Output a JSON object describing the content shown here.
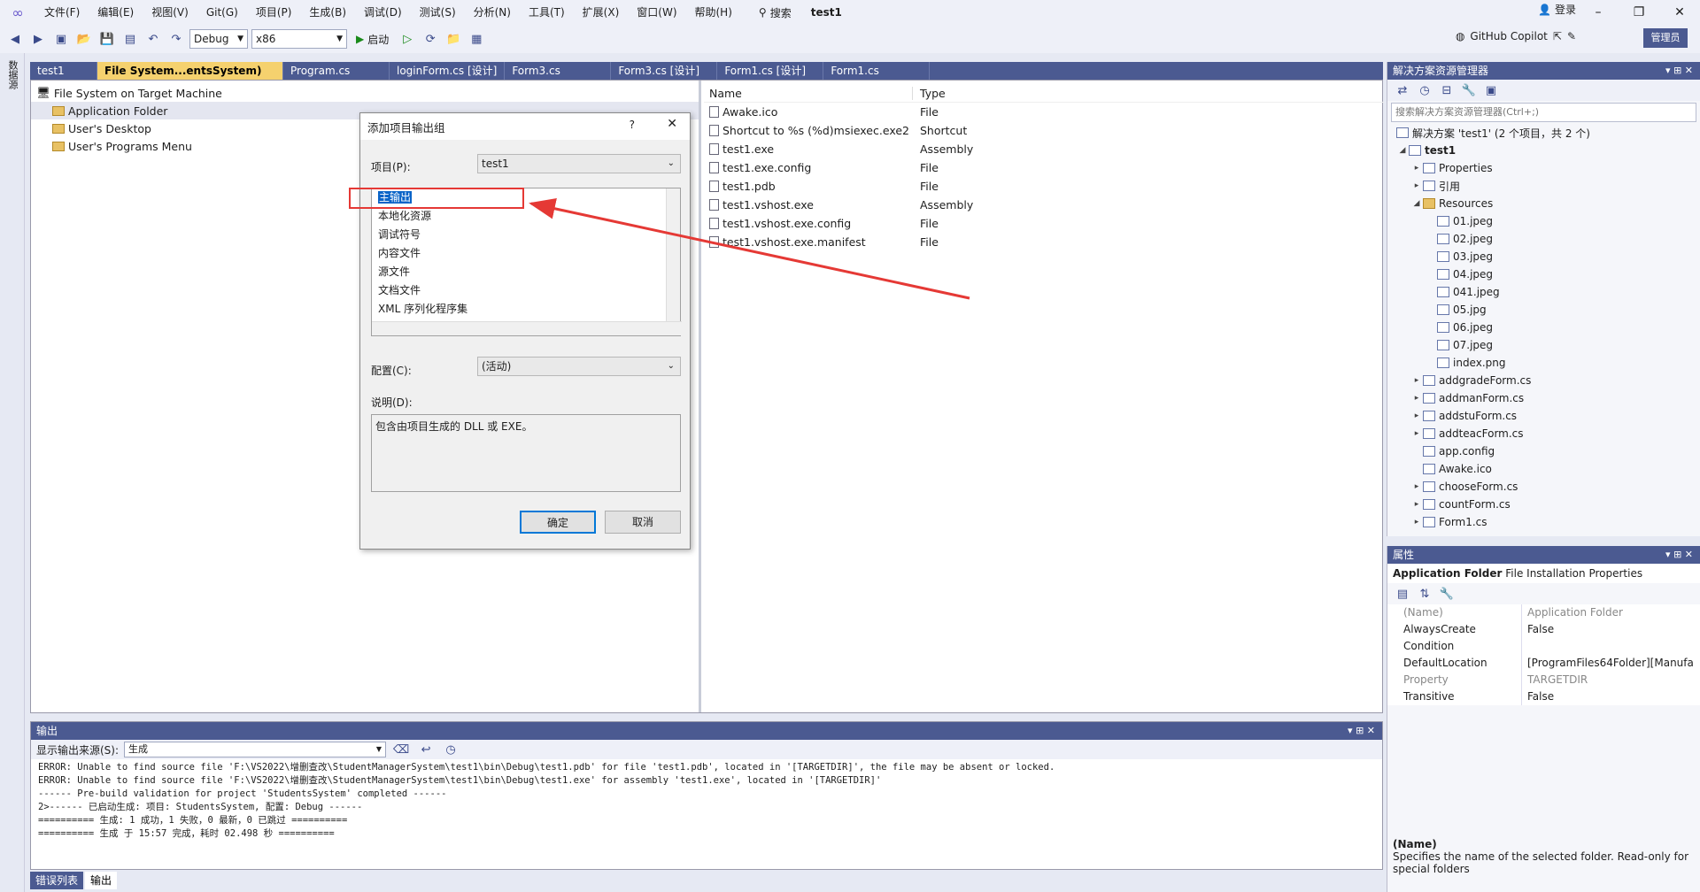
{
  "menubar": {
    "items": [
      "文件(F)",
      "编辑(E)",
      "视图(V)",
      "Git(G)",
      "项目(P)",
      "生成(B)",
      "调试(D)",
      "测试(S)",
      "分析(N)",
      "工具(T)",
      "扩展(X)",
      "窗口(W)",
      "帮助(H)"
    ],
    "search_label": "搜索",
    "project_title": "test1",
    "login_label": "登录"
  },
  "toolbar": {
    "config_value": "Debug",
    "platform_value": "x86",
    "start_label": "启动",
    "copilot_label": "GitHub Copilot",
    "admin_label": "管理员"
  },
  "tabs": [
    {
      "label": "test1"
    },
    {
      "label": "File System...entsSystem)"
    },
    {
      "label": "Program.cs"
    },
    {
      "label": "loginForm.cs [设计]"
    },
    {
      "label": "Form3.cs"
    },
    {
      "label": "Form3.cs [设计]"
    },
    {
      "label": "Form1.cs [设计]"
    },
    {
      "label": "Form1.cs"
    }
  ],
  "file_system": {
    "root": "File System on Target Machine",
    "folders": [
      "Application Folder",
      "User's Desktop",
      "User's Programs Menu"
    ]
  },
  "file_list": {
    "headers": {
      "name": "Name",
      "type": "Type"
    },
    "rows": [
      {
        "name": "Awake.ico",
        "type": "File"
      },
      {
        "name": "Shortcut to %s (%d)msiexec.exe2",
        "type": "Shortcut"
      },
      {
        "name": "test1.exe",
        "type": "Assembly"
      },
      {
        "name": "test1.exe.config",
        "type": "File"
      },
      {
        "name": "test1.pdb",
        "type": "File"
      },
      {
        "name": "test1.vshost.exe",
        "type": "Assembly"
      },
      {
        "name": "test1.vshost.exe.config",
        "type": "File"
      },
      {
        "name": "test1.vshost.exe.manifest",
        "type": "File"
      }
    ]
  },
  "dialog": {
    "title": "添加项目输出组",
    "help": "?",
    "project_label": "项目(P):",
    "project_value": "test1",
    "outputs": [
      "主输出",
      "本地化资源",
      "调试符号",
      "内容文件",
      "源文件",
      "文档文件",
      "XML 序列化程序集"
    ],
    "config_label": "配置(C):",
    "config_value": "(活动)",
    "desc_label": "说明(D):",
    "desc_text": "包含由项目生成的 DLL 或 EXE。",
    "ok_label": "确定",
    "cancel_label": "取消"
  },
  "solution": {
    "title": "解决方案资源管理器",
    "search_placeholder": "搜索解决方案资源管理器(Ctrl+;)",
    "solution_label": "解决方案 'test1' (2 个项目，共 2 个)",
    "project": "test1",
    "items": [
      {
        "label": "Properties",
        "level": 1,
        "expander": "▸"
      },
      {
        "label": "引用",
        "level": 1,
        "expander": "▸"
      },
      {
        "label": "Resources",
        "level": 1,
        "expander": "◢"
      },
      {
        "label": "01.jpeg",
        "level": 2,
        "expander": ""
      },
      {
        "label": "02.jpeg",
        "level": 2,
        "expander": ""
      },
      {
        "label": "03.jpeg",
        "level": 2,
        "expander": ""
      },
      {
        "label": "04.jpeg",
        "level": 2,
        "expander": ""
      },
      {
        "label": "041.jpeg",
        "level": 2,
        "expander": ""
      },
      {
        "label": "05.jpg",
        "level": 2,
        "expander": ""
      },
      {
        "label": "06.jpeg",
        "level": 2,
        "expander": ""
      },
      {
        "label": "07.jpeg",
        "level": 2,
        "expander": ""
      },
      {
        "label": "index.png",
        "level": 2,
        "expander": ""
      },
      {
        "label": "addgradeForm.cs",
        "level": 1,
        "expander": "▸"
      },
      {
        "label": "addmanForm.cs",
        "level": 1,
        "expander": "▸"
      },
      {
        "label": "addstuForm.cs",
        "level": 1,
        "expander": "▸"
      },
      {
        "label": "addteacForm.cs",
        "level": 1,
        "expander": "▸"
      },
      {
        "label": "app.config",
        "level": 1,
        "expander": ""
      },
      {
        "label": "Awake.ico",
        "level": 1,
        "expander": ""
      },
      {
        "label": "chooseForm.cs",
        "level": 1,
        "expander": "▸"
      },
      {
        "label": "countForm.cs",
        "level": 1,
        "expander": "▸"
      },
      {
        "label": "Form1.cs",
        "level": 1,
        "expander": "▸"
      }
    ]
  },
  "properties": {
    "title": "属性",
    "object_name": "Application Folder",
    "object_type": "File Installation Properties",
    "rows": [
      {
        "key": "(Name)",
        "value": "Application Folder",
        "muted": true
      },
      {
        "key": "AlwaysCreate",
        "value": "False",
        "muted": false
      },
      {
        "key": "Condition",
        "value": "",
        "muted": false
      },
      {
        "key": "DefaultLocation",
        "value": "[ProgramFiles64Folder][Manufa",
        "muted": false
      },
      {
        "key": "Property",
        "value": "TARGETDIR",
        "muted": true
      },
      {
        "key": "Transitive",
        "value": "False",
        "muted": false
      }
    ],
    "desc_title": "(Name)",
    "desc_text": "Specifies the name of the selected folder. Read-only for special folders"
  },
  "output": {
    "title": "输出",
    "source_label": "显示输出来源(S):",
    "source_value": "生成",
    "lines": [
      "ERROR: Unable to find source file 'F:\\VS2022\\增删查改\\StudentManagerSystem\\test1\\bin\\Debug\\test1.pdb' for file 'test1.pdb', located in '[TARGETDIR]', the file may be absent or locked.",
      "ERROR: Unable to find source file 'F:\\VS2022\\增删查改\\StudentManagerSystem\\test1\\bin\\Debug\\test1.exe' for assembly 'test1.exe', located in '[TARGETDIR]'",
      "------ Pre-build validation for project 'StudentsSystem' completed ------",
      "2>------ 已启动生成: 项目: StudentsSystem, 配置: Debug ------",
      "========== 生成: 1 成功，1 失败，0 最新，0 已跳过 ==========",
      "========== 生成 于 15:57 完成，耗时 02.498 秒 =========="
    ]
  },
  "bottom_tabs": [
    "错误列表",
    "输出"
  ],
  "left_strip_label": "数据源",
  "colors": {
    "accent": "#4b5a91",
    "active_tab": "#f5d16e",
    "annotation": "#e53935"
  }
}
